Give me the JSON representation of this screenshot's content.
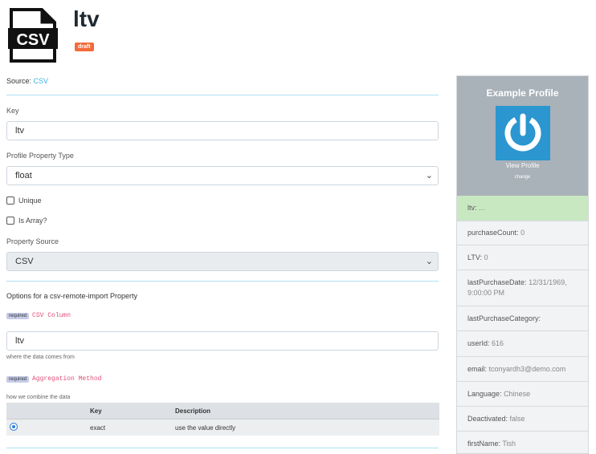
{
  "header": {
    "title": "ltv",
    "badge": "draft",
    "logo_text": "CSV"
  },
  "source": {
    "label": "Source: ",
    "value": "CSV"
  },
  "form": {
    "key_label": "Key",
    "key_value": "ltv",
    "type_label": "Profile Property Type",
    "type_value": "float",
    "unique_label": "Unique",
    "is_array_label": "Is Array?",
    "source_label": "Property Source",
    "source_value": "CSV",
    "options_heading": "Options for a csv-remote-import Property",
    "required_badge": "required",
    "csv_column_label": "CSV Column",
    "csv_column_value": "ltv",
    "csv_column_help": "where the data comes from",
    "aggregation_label": "Aggregation Method",
    "aggregation_help": "how we combine the data",
    "table": {
      "headers": [
        "Key",
        "Description"
      ],
      "rows": [
        {
          "key": "exact",
          "description": "use the value directly"
        }
      ]
    }
  },
  "panel": {
    "title": "Example Profile",
    "view_profile": "View Profile",
    "change": "change",
    "properties": [
      {
        "name": "ltv:",
        "value": "..."
      },
      {
        "name": "purchaseCount:",
        "value": "0"
      },
      {
        "name": "LTV:",
        "value": "0"
      },
      {
        "name": "lastPurchaseDate:",
        "value": "12/31/1969, 9:00:00 PM"
      },
      {
        "name": "lastPurchaseCategory:",
        "value": ""
      },
      {
        "name": "userId:",
        "value": "616"
      },
      {
        "name": "email:",
        "value": "tconyardh3@demo.com"
      },
      {
        "name": "Language:",
        "value": "Chinese"
      },
      {
        "name": "Deactivated:",
        "value": "false"
      },
      {
        "name": "firstName:",
        "value": "Tish"
      }
    ]
  },
  "icons": {
    "logo": "csv-file-icon",
    "avatar": "power-icon",
    "chevron": "chevron-down-icon"
  },
  "colors": {
    "badge": "#f26b3a",
    "link": "#3ab3e6",
    "highlight": "#c8e8c2",
    "panel_header": "#a9b1b9",
    "avatar": "#2b96d0"
  }
}
